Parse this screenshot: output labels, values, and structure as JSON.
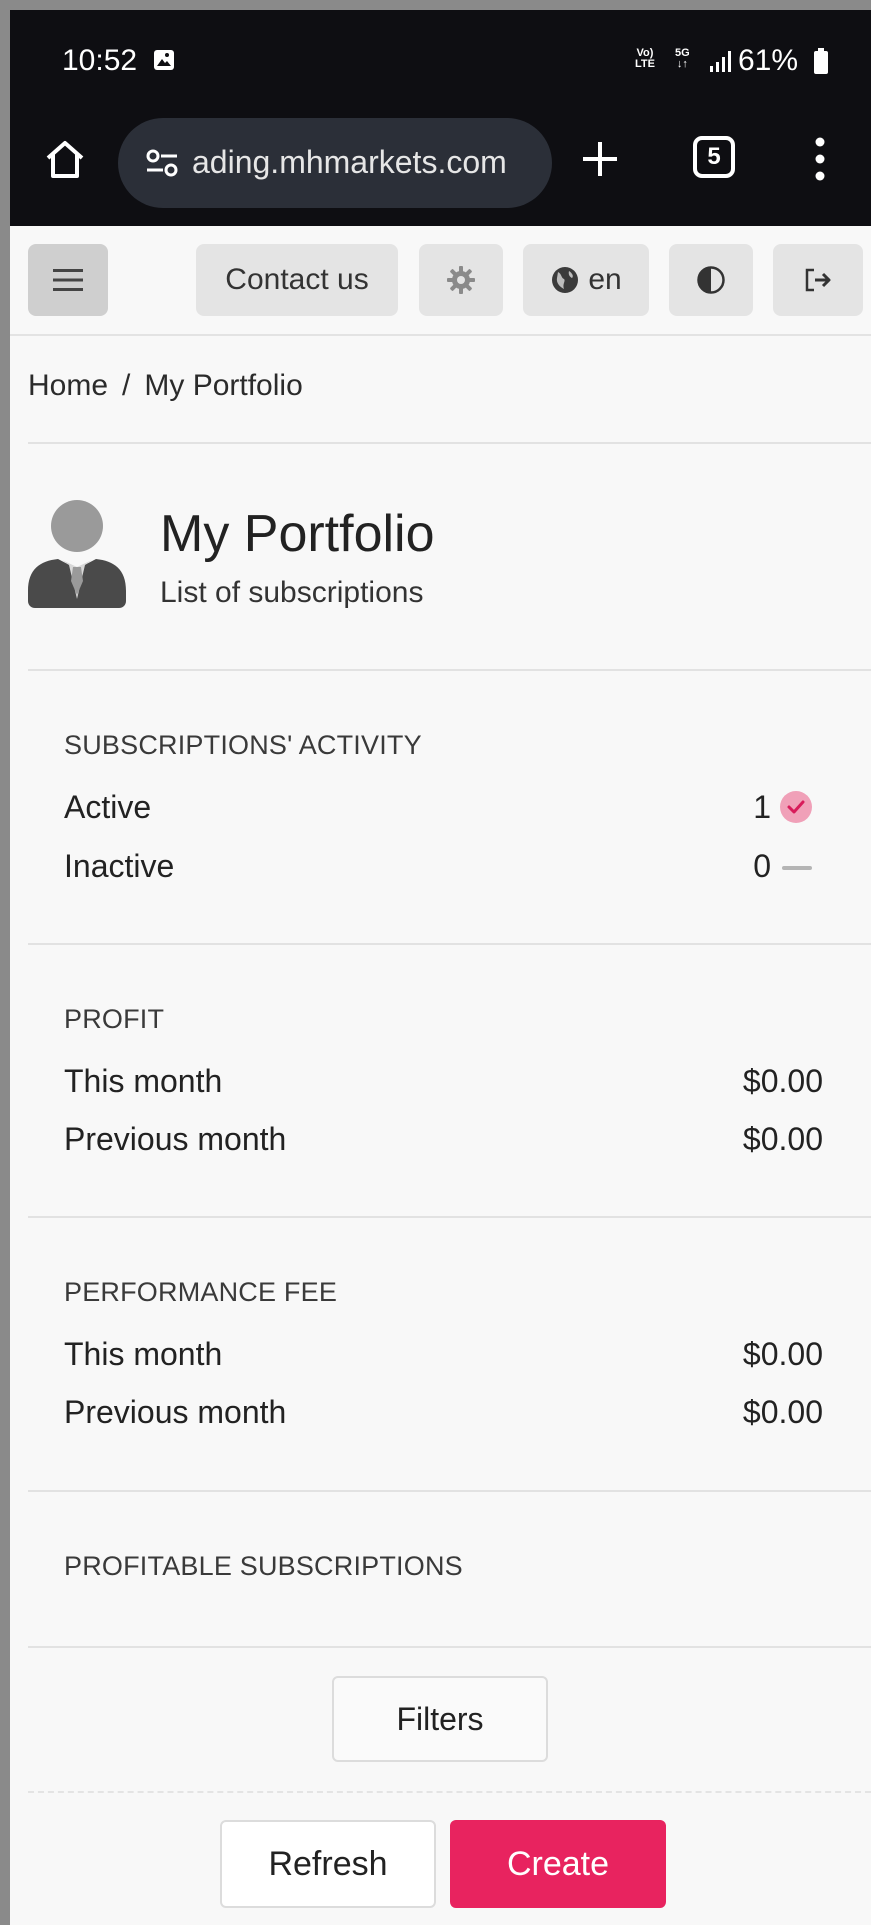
{
  "status_bar": {
    "time": "10:52",
    "volte": "Vo)\nLTE",
    "network": "5G\n↓↑",
    "battery": "61%"
  },
  "browser": {
    "url": "ading.mhmarkets.com",
    "tab_count": "5"
  },
  "nav": {
    "contact": "Contact us",
    "language": "en"
  },
  "breadcrumb": {
    "home": "Home",
    "separator": "/",
    "current": "My Portfolio"
  },
  "header": {
    "title": "My Portfolio",
    "subtitle": "List of subscriptions"
  },
  "activity": {
    "title": "SUBSCRIPTIONS' ACTIVITY",
    "active_label": "Active",
    "active_count": "1",
    "inactive_label": "Inactive",
    "inactive_count": "0"
  },
  "profit": {
    "title": "PROFIT",
    "this_month_label": "This month",
    "this_month_value": "$0.00",
    "prev_month_label": "Previous month",
    "prev_month_value": "$0.00"
  },
  "performance_fee": {
    "title": "PERFORMANCE FEE",
    "this_month_label": "This month",
    "this_month_value": "$0.00",
    "prev_month_label": "Previous month",
    "prev_month_value": "$0.00"
  },
  "profitable": {
    "title": "PROFITABLE SUBSCRIPTIONS"
  },
  "actions": {
    "filters": "Filters",
    "refresh": "Refresh",
    "create": "Create"
  },
  "colors": {
    "accent": "#e8235f",
    "check": "#e8235f"
  }
}
